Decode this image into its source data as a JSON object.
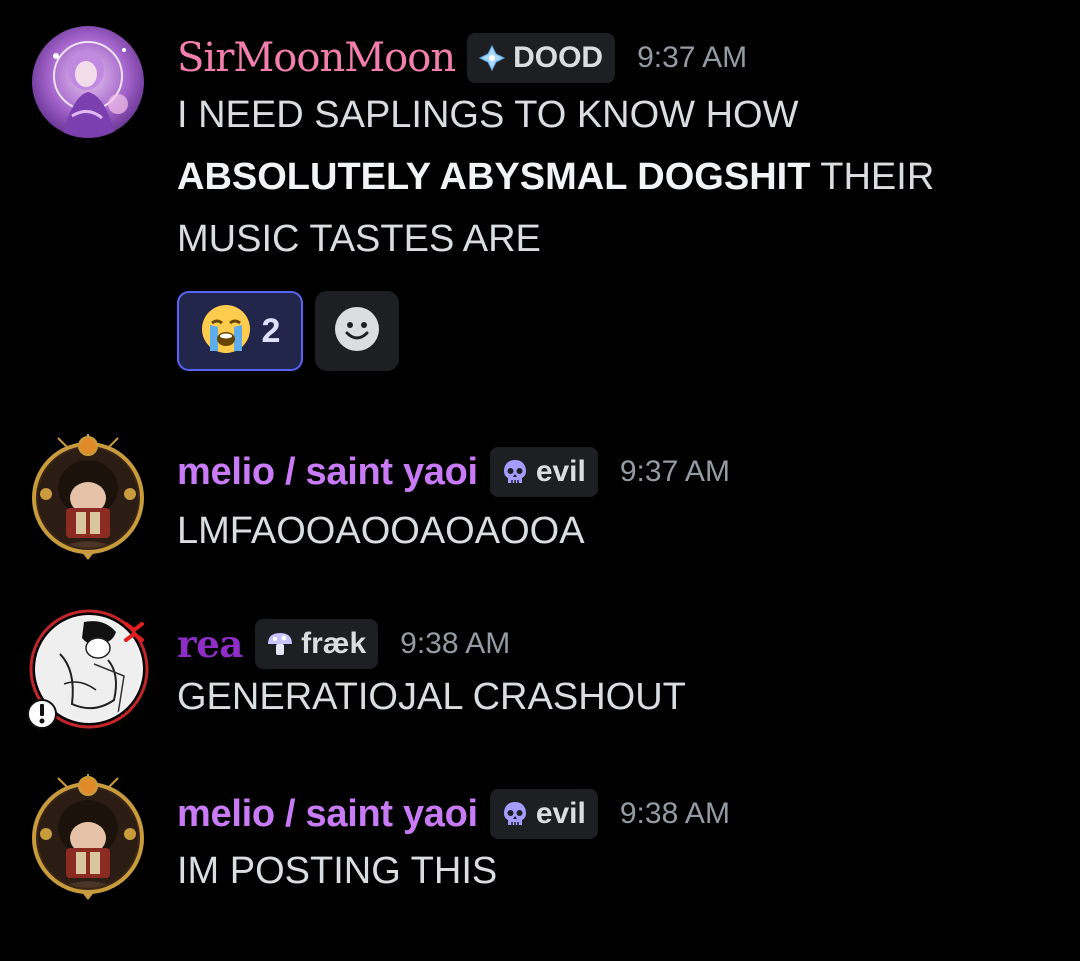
{
  "messages": [
    {
      "username": "SirMoonMoon",
      "username_color": "#f47fae",
      "tag": {
        "icon": "diamond-sparkle-icon",
        "label": "DOOD"
      },
      "timestamp": "9:37 AM",
      "content": {
        "line1": "I NEED SAPLINGS TO KNOW HOW",
        "bold": "ABSOLUTELY ABYSMAL DOGSHIT",
        "line2_rest": " THEIR",
        "line3": "MUSIC TASTES ARE"
      },
      "reactions": [
        {
          "emoji": "loudly-crying-face-icon",
          "count": "2"
        },
        {
          "emoji": "add-reaction-smiley-icon"
        }
      ]
    },
    {
      "username": "melio / saint yaoi",
      "username_color": "#c97bf7",
      "tag": {
        "icon": "skull-icon",
        "label": "evil"
      },
      "timestamp": "9:37 AM",
      "content": "LMFAOOAOOAOAOOA"
    },
    {
      "username": "rea",
      "username_color": "#8e2ec7",
      "tag": {
        "icon": "mushroom-icon",
        "label": "fræk"
      },
      "timestamp": "9:38 AM",
      "content": "GENERATIOJAL CRASHOUT"
    },
    {
      "username": "melio / saint yaoi",
      "username_color": "#c97bf7",
      "tag": {
        "icon": "skull-icon",
        "label": "evil"
      },
      "timestamp": "9:38 AM",
      "content": "IM POSTING THIS"
    }
  ],
  "colors": {
    "background": "#000000",
    "text": "#dbdee1",
    "timestamp": "#949ba4",
    "tag_bg": "#1e1f22",
    "reaction_active_bg": "#22264b",
    "reaction_active_border": "#5865f2"
  }
}
